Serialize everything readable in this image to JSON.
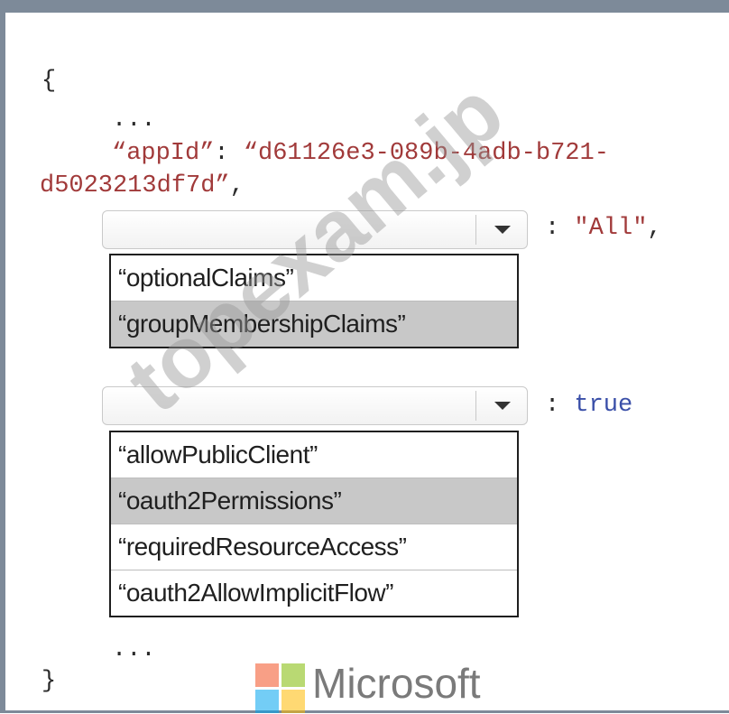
{
  "code": {
    "open_brace": "{",
    "ellipsis_top": "...",
    "appid_key": "“appId”",
    "colon": ":",
    "appid_value_part1": "“d61126e3-089b-4adb-b721-",
    "appid_value_part2": "d5023213df7d”",
    "comma": ",",
    "value_all": "\"All\"",
    "value_true": "true",
    "ellipsis_bottom": "...",
    "close_brace": "}"
  },
  "dropdown1": {
    "selected": "",
    "options": [
      "“optionalClaims”",
      "“groupMembershipClaims”"
    ],
    "highlighted_index": 1
  },
  "dropdown2": {
    "selected": "",
    "options": [
      "“allowPublicClient”",
      "“oauth2Permissions”",
      "“requiredResourceAccess”",
      "“oauth2AllowImplicitFlow”"
    ],
    "highlighted_index": 1
  },
  "watermark": "topexam.jp",
  "brand": {
    "name": "Microsoft",
    "logo_colors": [
      "#f25022",
      "#7fba00",
      "#00a4ef",
      "#ffb900"
    ]
  }
}
